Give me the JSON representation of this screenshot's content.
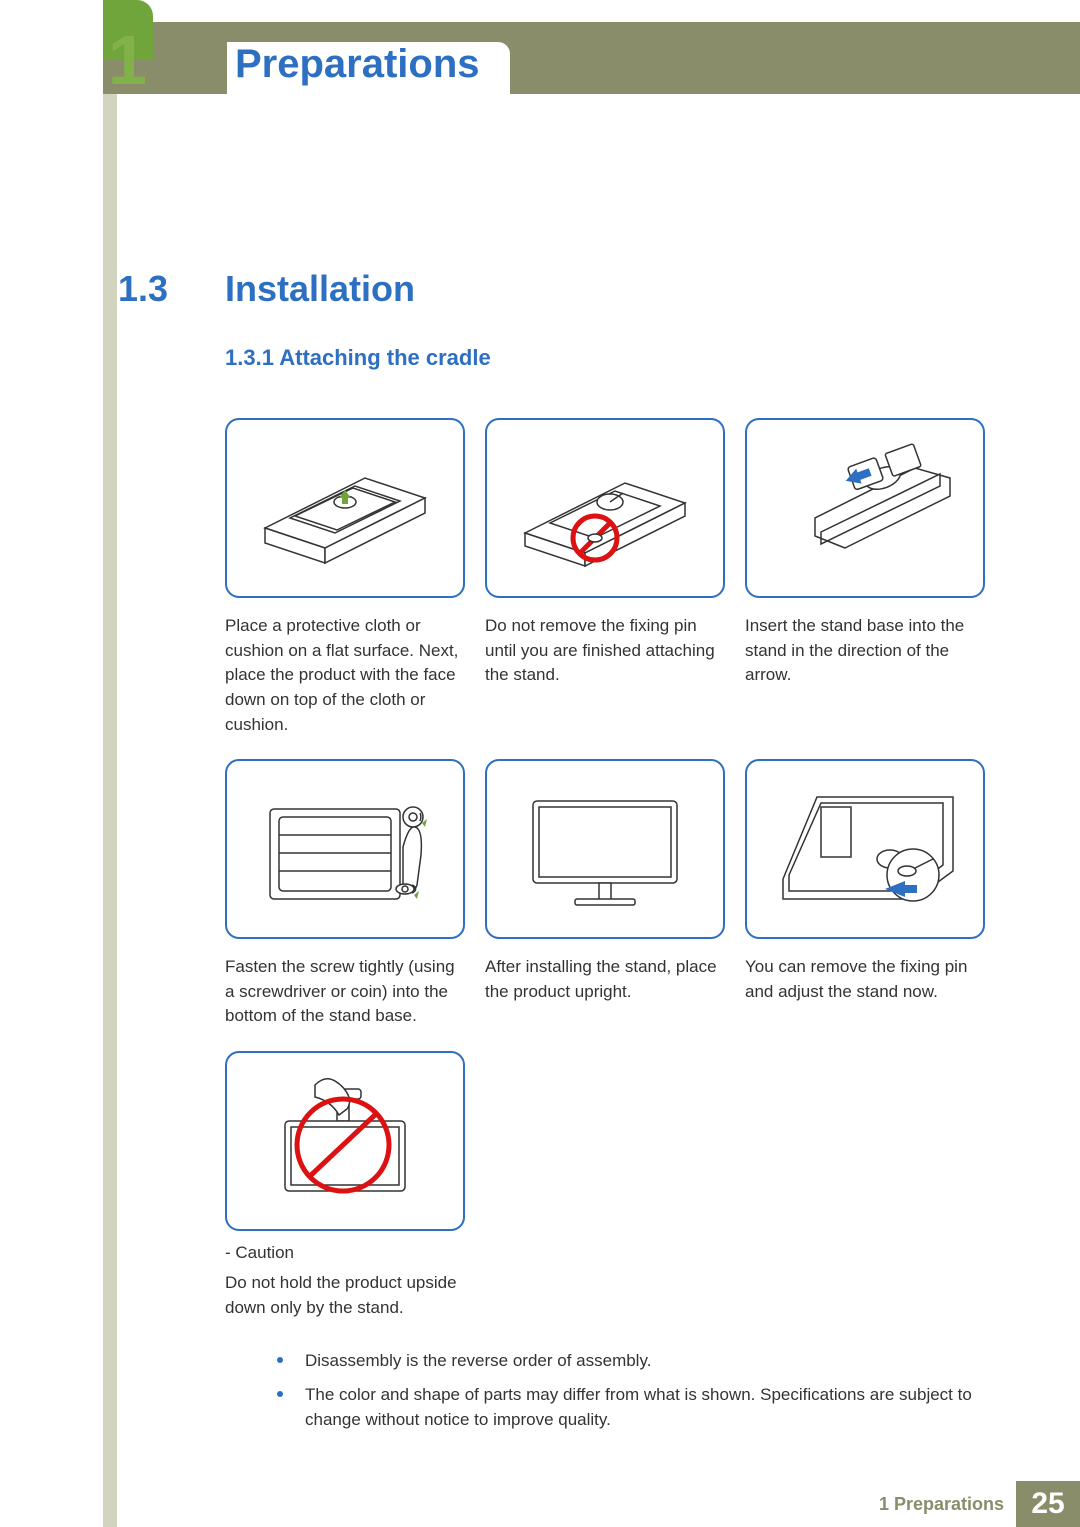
{
  "chapter": {
    "number": "1",
    "title": "Preparations"
  },
  "section": {
    "number": "1.3",
    "title": "Installation"
  },
  "subsection": {
    "number": "1.3.1",
    "title": "Attaching the cradle",
    "full": "1.3.1  Attaching the cradle"
  },
  "steps": [
    {
      "caption": "Place a protective cloth or cushion on a flat surface. Next, place the product with the face down on top of the cloth or cushion."
    },
    {
      "caption": "Do not remove the fixing pin until you are finished attaching the stand."
    },
    {
      "caption": "Insert the stand base into the stand in the direction of the arrow."
    },
    {
      "caption": "Fasten the screw tightly (using a screwdriver or coin) into the bottom of the stand base."
    },
    {
      "caption": "After installing the stand, place the product upright."
    },
    {
      "caption": "You can remove the fixing pin and adjust the stand now."
    }
  ],
  "caution": {
    "label": "- Caution",
    "text": "Do not hold the product upside down only by the stand."
  },
  "notes": [
    "Disassembly is the reverse order of assembly.",
    "The color and shape of parts may differ from what is shown. Specifications are subject to change without notice to improve quality."
  ],
  "footer": {
    "label": "1 Preparations",
    "page": "25"
  }
}
